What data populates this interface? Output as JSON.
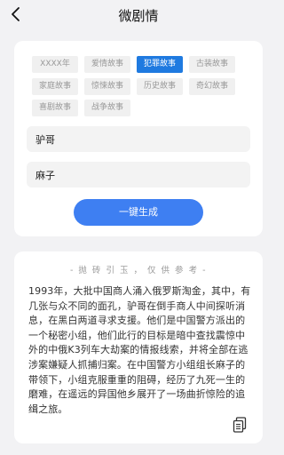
{
  "header": {
    "title": "微剧情"
  },
  "tags": [
    {
      "label": "XXXX年",
      "selected": false
    },
    {
      "label": "爱情故事",
      "selected": false
    },
    {
      "label": "犯罪故事",
      "selected": true
    },
    {
      "label": "古装故事",
      "selected": false
    },
    {
      "label": "家庭故事",
      "selected": false
    },
    {
      "label": "惊悚故事",
      "selected": false
    },
    {
      "label": "历史故事",
      "selected": false
    },
    {
      "label": "奇幻故事",
      "selected": false
    },
    {
      "label": "喜剧故事",
      "selected": false
    },
    {
      "label": "战争故事",
      "selected": false
    }
  ],
  "inputs": {
    "name1": "驴哥",
    "name2": "麻子"
  },
  "generate_label": "一键生成",
  "result": {
    "hint": "- 抛 砖 引 玉 ， 仅 供 参 考 -",
    "story": "1993年，大批中国商人涌入俄罗斯淘金，其中，有几张与众不同的面孔，驴哥在倒手商人中间探听消息，在黑白两道寻求支援。他们是中国警方派出的一个秘密小组，他们此行的目标是暗中查找震惊中外的中俄K3列车大劫案的情报线索，并将全部在逃涉案嫌疑人抓捕归案。在中国警方小组组长麻子的带领下，小组克服重重的阻碍，经历了九死一生的磨难，在遥远的异国他乡展开了一场曲折惊险的追缉之旅。"
  },
  "colors": {
    "accent": "#3e7ff2",
    "selected_tag": "#1f7ae0",
    "background": "#f2f2f4"
  },
  "icons": {
    "back": "chevron-left-icon",
    "copy": "copy-icon"
  }
}
